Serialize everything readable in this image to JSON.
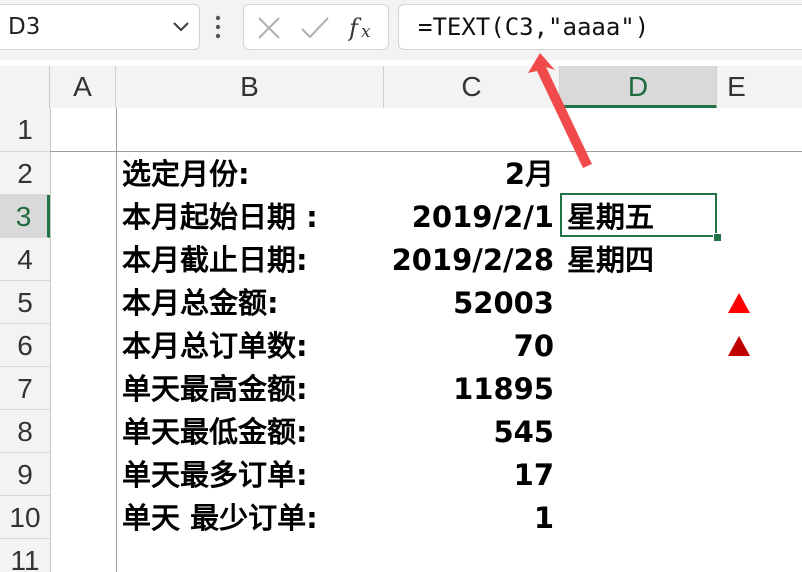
{
  "namebox": {
    "value": "D3"
  },
  "formula_bar": {
    "formula": "=TEXT(C3,\"aaaa\")"
  },
  "columns": [
    "A",
    "B",
    "C",
    "D",
    "E"
  ],
  "rows": [
    "1",
    "2",
    "3",
    "4",
    "5",
    "6",
    "7",
    "8",
    "9",
    "10",
    "11"
  ],
  "selected": {
    "column": "D",
    "row": "3"
  },
  "cells": {
    "B2": "选定月份:",
    "C2": "2月",
    "B3": "本月起始日期 :",
    "C3": "2019/2/1",
    "D3": "星期五",
    "B4": "本月截止日期:",
    "C4": "2019/2/28",
    "D4": "星期四",
    "B5": "本月总金额:",
    "C5": "52003",
    "B6": "本月总订单数:",
    "C6": "70",
    "B7": "单天最高金额:",
    "C7": "11895",
    "B8": "单天最低金额:",
    "C8": "545",
    "B9": "单天最多订单:",
    "C9": "17",
    "B10": "单天 最少订单:",
    "C10": "1"
  },
  "markers": [
    {
      "row": "5",
      "shape": "triangle-up",
      "color": "#ff0000"
    },
    {
      "row": "6",
      "shape": "triangle-up",
      "color": "#c00000"
    }
  ],
  "annotation": {
    "shape": "arrow",
    "color": "#f04a4a",
    "points_to": "formula"
  },
  "colors": {
    "accent": "#217346",
    "header_bg": "#f3f3f3",
    "selected_header_bg": "#d9d9d9"
  }
}
